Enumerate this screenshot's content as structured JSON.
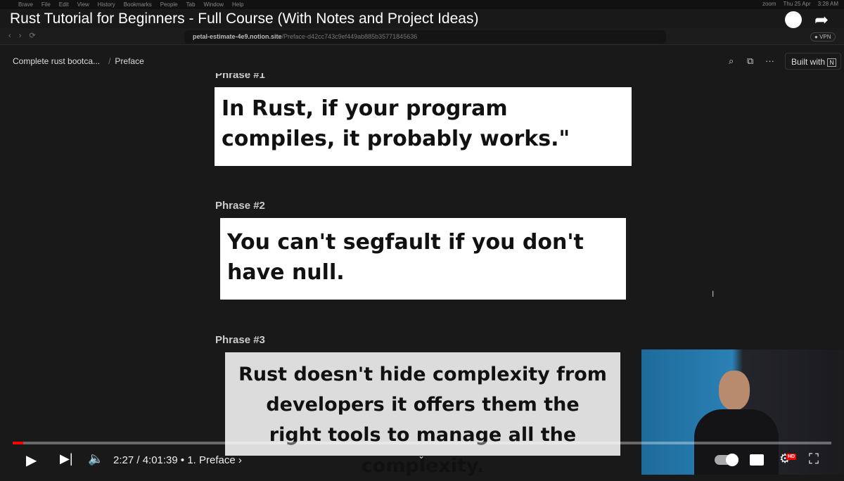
{
  "menubar": {
    "items": [
      "Brave",
      "File",
      "Edit",
      "View",
      "History",
      "Bookmarks",
      "People",
      "Tab",
      "Window",
      "Help"
    ],
    "right": [
      "zoom",
      "Thu 25 Apr",
      "3:28 AM"
    ]
  },
  "video": {
    "title": "Rust Tutorial for Beginners - Full Course (With Notes and Project Ideas)",
    "time": "2:27 / 4:01:39",
    "chapter": "• 1. Preface ›",
    "progress_fraction": 0.01,
    "accent": "#ff0000"
  },
  "browser": {
    "url_host": "petal-estimate-4e9.notion.site",
    "url_path": "/Preface-d42cc743c9ef449ab885b35771845636",
    "vpn": "VPN"
  },
  "notion": {
    "breadcrumb": [
      "Complete rust bootca...",
      "Preface"
    ],
    "built_with": "Built with",
    "notion_logo": "N"
  },
  "content": {
    "phrases": [
      {
        "heading": "Phrase #1",
        "text": "In Rust, if your program compiles, it probably works.\""
      },
      {
        "heading": "Phrase #2",
        "text": "You can't segfault if you don't have null."
      },
      {
        "heading": "Phrase #3",
        "text": "Rust doesn't hide complexity from developers it offers them the right tools to manage all the complexity."
      }
    ]
  }
}
